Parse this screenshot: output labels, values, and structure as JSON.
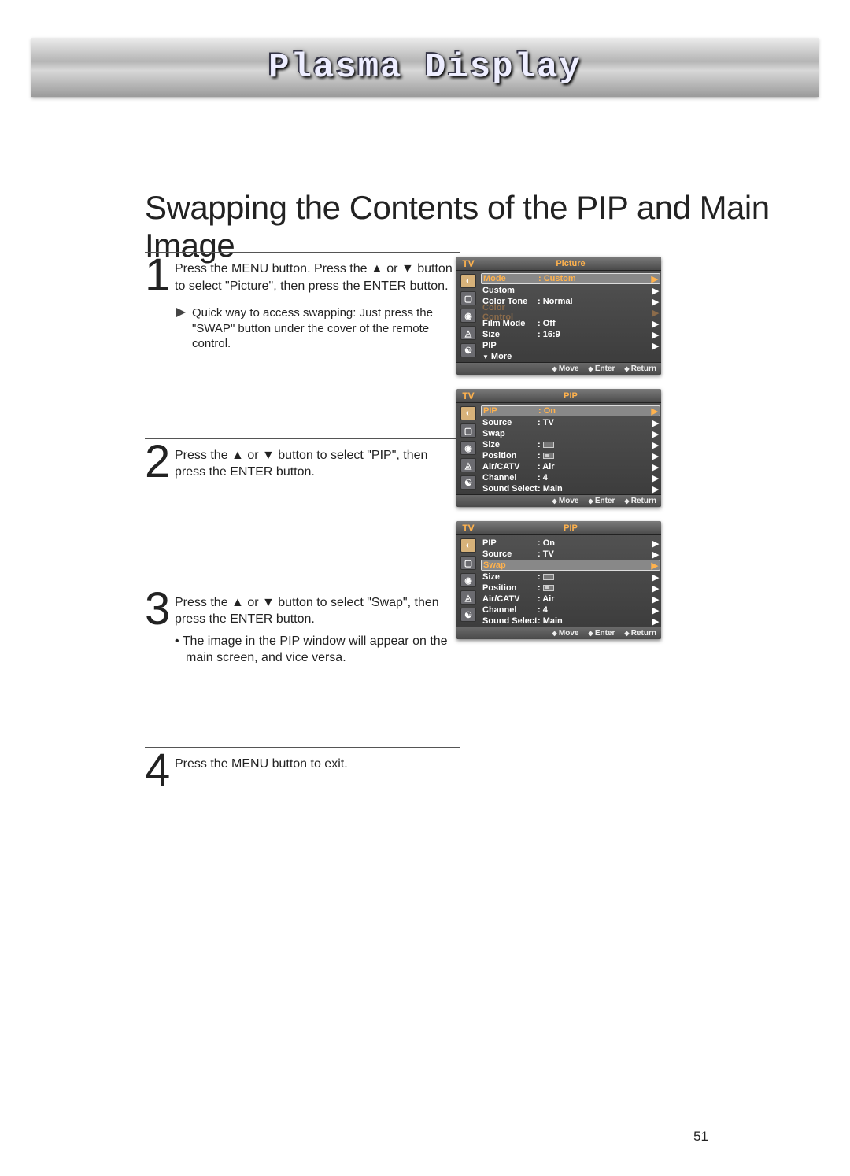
{
  "banner_title": "Plasma Display",
  "page_title": "Swapping the Contents of the PIP and Main Image",
  "page_num": "51",
  "steps": [
    {
      "num": "1",
      "text": "Press the MENU button. Press the ▲ or ▼ button to select \"Picture\", then press the ENTER button.",
      "note": "Quick way to access swapping: Just press the \"SWAP\" button under the cover of the remote control."
    },
    {
      "num": "2",
      "text": "Press the ▲ or ▼ button to select \"PIP\", then press the ENTER button."
    },
    {
      "num": "3",
      "text": "Press the ▲ or ▼ button to select \"Swap\", then press the ENTER button.",
      "bullet": "The image in the PIP window will appear on the main screen, and vice versa."
    },
    {
      "num": "4",
      "text": "Press the MENU button to exit."
    }
  ],
  "osd_common": {
    "tv_label": "TV",
    "foot_move": "Move",
    "foot_enter": "Enter",
    "foot_return": "Return"
  },
  "osd1": {
    "title": "Picture",
    "rows": [
      {
        "label": "Mode",
        "value": ":  Custom",
        "hl": true,
        "arrow": true
      },
      {
        "label": "Custom",
        "value": "",
        "arrow": true
      },
      {
        "label": "Color Tone",
        "value": ":  Normal",
        "arrow": true
      },
      {
        "label": "Color Control",
        "value": "",
        "disabled": true,
        "arrow": true
      },
      {
        "label": "Film Mode",
        "value": ":  Off",
        "arrow": true
      },
      {
        "label": "Size",
        "value": ":  16:9",
        "arrow": true
      },
      {
        "label": "PIP",
        "value": "",
        "arrow": true
      },
      {
        "label": "More",
        "value": "",
        "more": true
      }
    ]
  },
  "osd2": {
    "title": "PIP",
    "rows": [
      {
        "label": "PIP",
        "value": ":  On",
        "hl": true,
        "arrow": true
      },
      {
        "label": "Source",
        "value": ":  TV",
        "arrow": true
      },
      {
        "label": "Swap",
        "value": "",
        "arrow": true
      },
      {
        "label": "Size",
        "value": ":  ",
        "rect": "size",
        "arrow": true
      },
      {
        "label": "Position",
        "value": ":  ",
        "rect": "pos",
        "arrow": true
      },
      {
        "label": "Air/CATV",
        "value": ":  Air",
        "arrow": true
      },
      {
        "label": "Channel",
        "value": ":  4",
        "arrow": true
      },
      {
        "label": "Sound Select",
        "value": ":  Main",
        "arrow": true
      }
    ]
  },
  "osd3": {
    "title": "PIP",
    "rows": [
      {
        "label": "PIP",
        "value": ":  On",
        "arrow": true
      },
      {
        "label": "Source",
        "value": ":  TV",
        "arrow": true
      },
      {
        "label": "Swap",
        "value": "",
        "hl": true,
        "arrow": true
      },
      {
        "label": "Size",
        "value": ":  ",
        "rect": "size",
        "arrow": true
      },
      {
        "label": "Position",
        "value": ":  ",
        "rect": "pos",
        "arrow": true
      },
      {
        "label": "Air/CATV",
        "value": ":  Air",
        "arrow": true
      },
      {
        "label": "Channel",
        "value": ":  4",
        "arrow": true
      },
      {
        "label": "Sound Select",
        "value": ":  Main",
        "arrow": true
      }
    ]
  }
}
